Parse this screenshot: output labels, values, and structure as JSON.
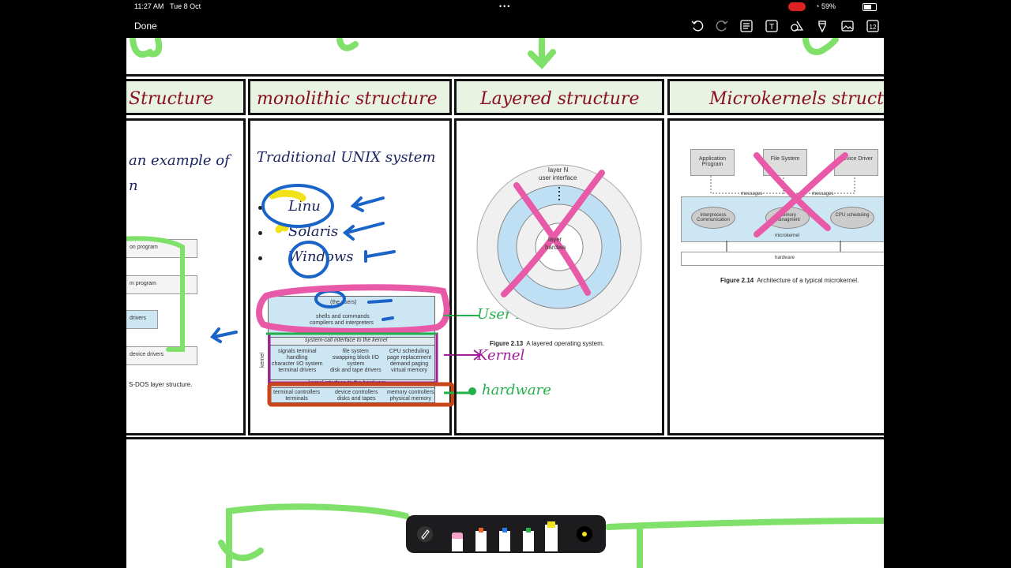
{
  "status": {
    "time": "11:27 AM",
    "date": "Tue 8 Oct",
    "battery": "59%"
  },
  "toolbar": {
    "done_label": "Done",
    "page_count": "12",
    "text_tool": "T"
  },
  "slides": {
    "col1": {
      "title": "Structure",
      "text_line1": "an example of",
      "text_line2": "n",
      "labels": [
        "on program",
        "m program",
        "drivers",
        "device drivers"
      ],
      "caption": "S-DOS layer structure."
    },
    "col2": {
      "title": "monolithic structure",
      "heading": "Traditional UNIX system",
      "bullets": [
        "Linu",
        "Solaris",
        "Windows"
      ],
      "diagram": {
        "users": "(the users)",
        "shells": "shells and commands",
        "compilers": "compilers and interpreters",
        "syscall": "system-call interface to the kernel",
        "kernel_label": "kernel",
        "col_a": [
          "signals terminal",
          "handling",
          "character I/O system",
          "terminal drivers"
        ],
        "col_b": [
          "file system",
          "swapping block I/O",
          "system",
          "disk and tape drivers"
        ],
        "col_c": [
          "CPU scheduling",
          "page replacement",
          "demand paging",
          "virtual memory"
        ],
        "hw_iface": "kernel interface to the hardware",
        "hw_a": [
          "terminal controllers",
          "terminals"
        ],
        "hw_b": [
          "device controllers",
          "disks and tapes"
        ],
        "hw_c": [
          "memory controllers",
          "physical memory"
        ]
      },
      "annotations": {
        "user_mode": "User Mode",
        "kernel": "Kernel",
        "hardware": "hardware"
      }
    },
    "col3": {
      "title": "Layered structure",
      "layer_n": "layer N",
      "user_iface": "user interface",
      "layer0": "layer",
      "hw": "hardwa",
      "caption_bold": "Figure 2.13",
      "caption": "A layered operating system."
    },
    "col4": {
      "title": "Microkernels structu",
      "boxes": [
        "Application Program",
        "File System",
        "Device Driver"
      ],
      "messages": [
        "messages",
        "messages"
      ],
      "ovals": [
        "Interprocess Communication",
        "memory managment",
        "CPU scheduling"
      ],
      "microkernel": "microkernel",
      "hardware": "hardware",
      "caption_bold": "Figure 2.14",
      "caption": "Architecture of a typical microkernel."
    }
  },
  "colors": {
    "title_red": "#8a1020",
    "ink_green": "#22b04a",
    "ink_blue": "#1a64c8",
    "ink_pink": "#e85aa8",
    "ink_yellow": "#f2e21a",
    "ink_purple": "#a0209a",
    "ink_orange": "#c8461a"
  }
}
